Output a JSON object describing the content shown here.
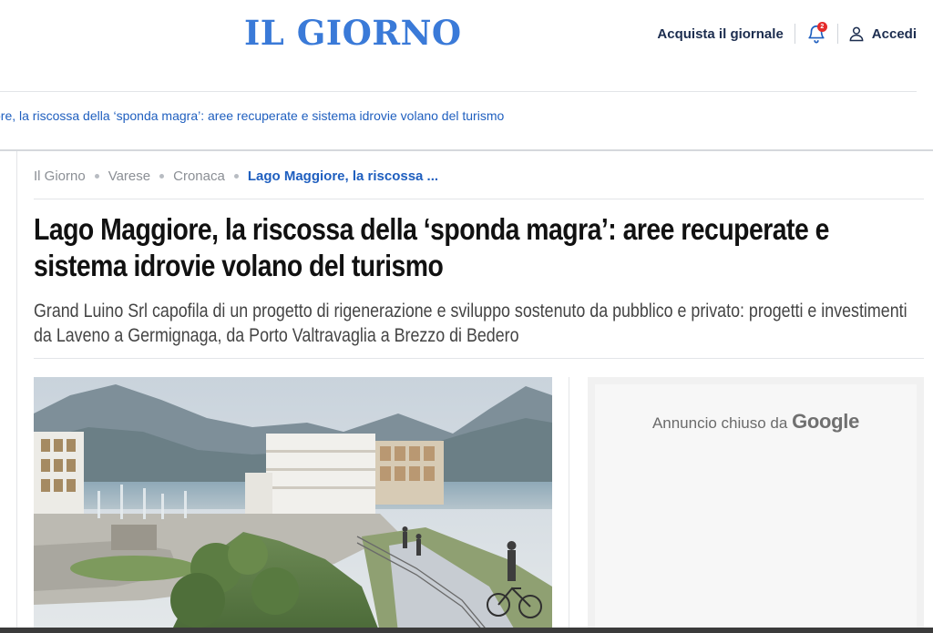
{
  "header": {
    "logo": "IL GIORNO",
    "buy_label": "Acquista il giornale",
    "notifications_count": "2",
    "login_label": "Accedi"
  },
  "ticker": {
    "text": "ore, la riscossa della ‘sponda magra’: aree recuperate e sistema idrovie volano del turismo"
  },
  "breadcrumb": {
    "items": [
      "Il Giorno",
      "Varese",
      "Cronaca"
    ],
    "current": "Lago Maggiore, la riscossa ..."
  },
  "article": {
    "title": "Lago Maggiore, la riscossa della ‘sponda magra’: aree recuperate e sistema idrovie volano del turismo",
    "summary": "Grand Luino Srl capofila di un progetto di rigenerazione e sviluppo sostenuto da pubblico e privato: progetti e investimenti da Laveno a Germignaga, da Porto Valtravaglia a Brezzo di Bedero"
  },
  "ad": {
    "closed_text": "Annuncio chiuso da",
    "brand": "Google"
  },
  "colors": {
    "brand_blue": "#3a7ad8",
    "link_blue": "#1f5fbf",
    "navy": "#1c2d4f",
    "badge_red": "#e52b2b"
  }
}
